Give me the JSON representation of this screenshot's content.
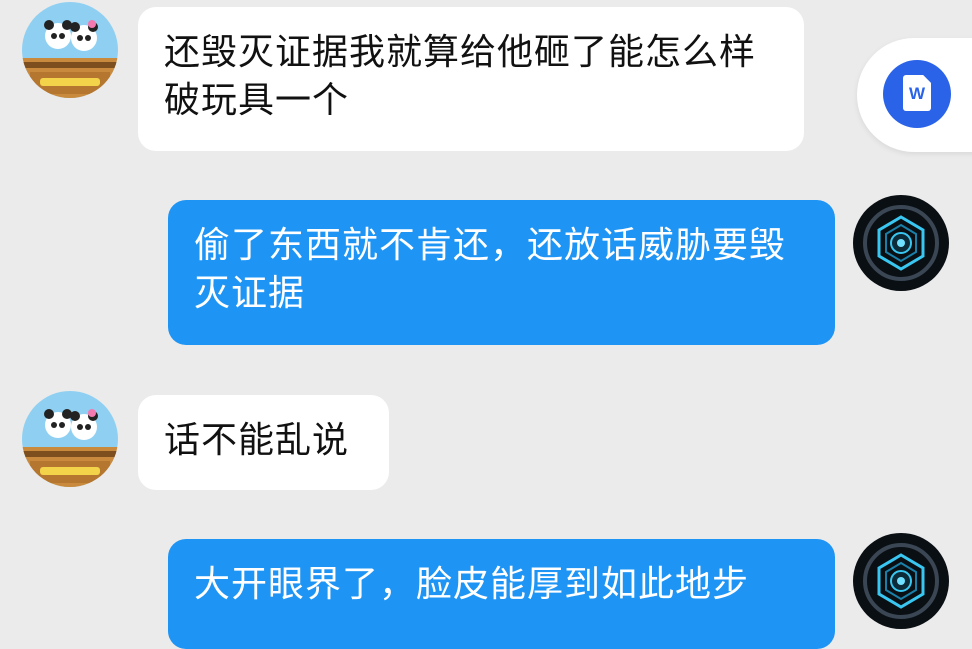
{
  "messages": [
    {
      "sender": "other",
      "avatar": "panda-avatar",
      "text": "还毁灭证据我就算给他砸了能怎么样破玩具一个"
    },
    {
      "sender": "self",
      "avatar": "tech-avatar",
      "text": "偷了东西就不肯还，还放话威胁要毁灭证据"
    },
    {
      "sender": "other",
      "avatar": "panda-avatar",
      "text": "话不能乱说"
    },
    {
      "sender": "self",
      "avatar": "tech-avatar",
      "text": "大开眼界了，脸皮能厚到如此地步"
    }
  ],
  "floating_button": {
    "icon": "word-document-icon",
    "letter": "W",
    "color": "#2b63e8"
  },
  "colors": {
    "background": "#ebebeb",
    "incoming_bubble": "#ffffff",
    "outgoing_bubble": "#1e95f5"
  }
}
